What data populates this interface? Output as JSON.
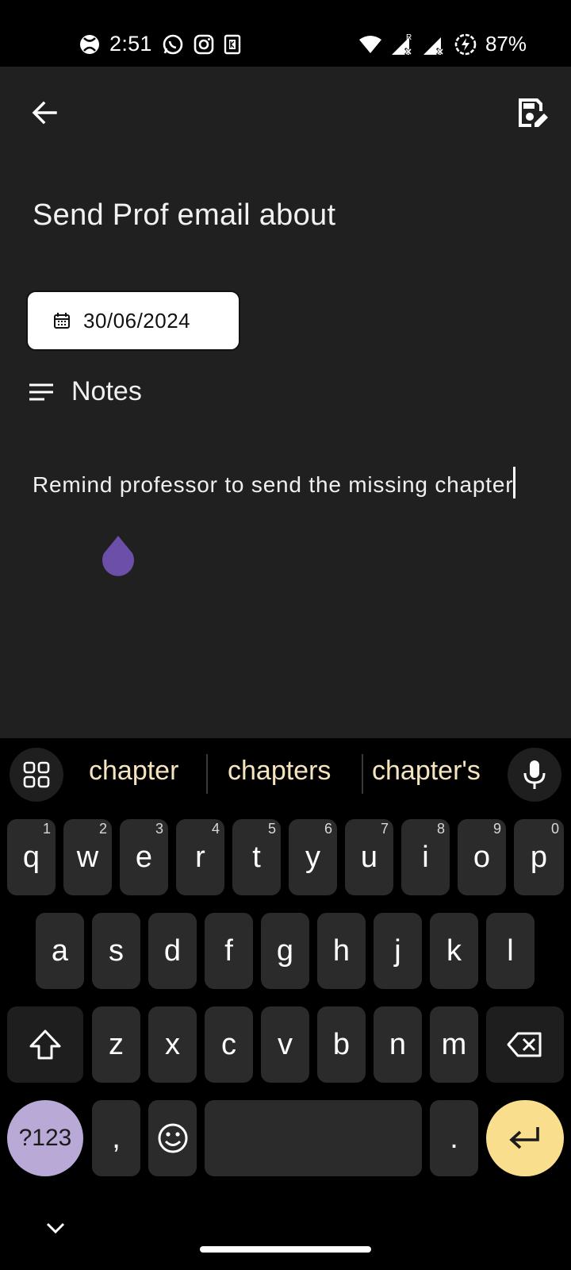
{
  "status_bar": {
    "time": "2:51",
    "battery": "87%",
    "icons": [
      "xbox-icon",
      "whatsapp-icon",
      "instagram-icon",
      "app-k-icon",
      "wifi-icon",
      "signal-r-icon",
      "signal-icon",
      "battery-saver-icon"
    ]
  },
  "app_bar": {
    "back_icon": "arrow-back-icon",
    "save_icon": "save-edit-icon"
  },
  "task": {
    "title": "Send Prof email about",
    "date": "30/06/2024",
    "notes_label": "Notes",
    "note_text": "Remind professor to send the missing chapter"
  },
  "keyboard": {
    "suggestions": [
      "chapter",
      "chapters",
      "chapter's"
    ],
    "row1": [
      {
        "key": "q",
        "hint": "1"
      },
      {
        "key": "w",
        "hint": "2"
      },
      {
        "key": "e",
        "hint": "3"
      },
      {
        "key": "r",
        "hint": "4"
      },
      {
        "key": "t",
        "hint": "5"
      },
      {
        "key": "y",
        "hint": "6"
      },
      {
        "key": "u",
        "hint": "7"
      },
      {
        "key": "i",
        "hint": "8"
      },
      {
        "key": "o",
        "hint": "9"
      },
      {
        "key": "p",
        "hint": "0"
      }
    ],
    "row2": [
      "a",
      "s",
      "d",
      "f",
      "g",
      "h",
      "j",
      "k",
      "l"
    ],
    "row3": [
      "z",
      "x",
      "c",
      "v",
      "b",
      "n",
      "m"
    ],
    "symbols_label": "?123",
    "comma": ",",
    "period": ".",
    "accent_colors": {
      "symbols": "#b9a9d6",
      "enter": "#f9de8e",
      "suggestion_text": "#f5e4be"
    }
  }
}
